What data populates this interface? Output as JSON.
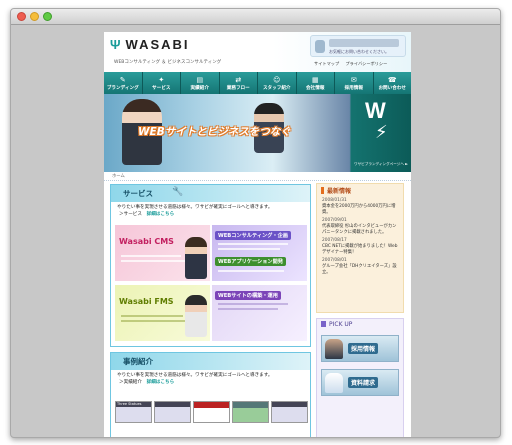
{
  "window": {
    "controls": [
      "close",
      "minimize",
      "zoom"
    ]
  },
  "header": {
    "logo": "WASABI",
    "tagline": "WEBコンサルティング ＆ ビジネスコンサルティング",
    "contact_sub": "お気軽にお問い合わせください。",
    "util_links": [
      "サイトマップ",
      "プライバシーポリシー"
    ]
  },
  "nav": [
    {
      "label": "ブランディング",
      "icon": "✎"
    },
    {
      "label": "サービス",
      "icon": "✦"
    },
    {
      "label": "実績紹介",
      "icon": "▤"
    },
    {
      "label": "業務フロー",
      "icon": "⇄"
    },
    {
      "label": "スタッフ紹介",
      "icon": "☺"
    },
    {
      "label": "会社情報",
      "icon": "▦"
    },
    {
      "label": "採用情報",
      "icon": "✉"
    },
    {
      "label": "お問い合わせ",
      "icon": "☎"
    }
  ],
  "hero": {
    "slogan": "WEBサイトとビジネスをつなぐ",
    "w_letter": "W",
    "w_caption": "ワサビブランディングページへ ►"
  },
  "breadcrumb": "ホーム",
  "service": {
    "title": "サービス",
    "desc": "やりたい事を実現させる道筋は様々。ワサビが確実にゴールへと導きます。",
    "link_prefix": "＞サービス",
    "link": "詳細はこちら",
    "tiles": {
      "cms": "Wasabi CMS",
      "consult": "WEBコンサルティング・企画",
      "fms": "Wasabi FMS",
      "app": "WEBアプリケーション開発",
      "ops": "WEBサイトの構築・運用"
    }
  },
  "cases": {
    "title": "事例紹介",
    "desc": "やりたい事を実現させる道筋は様々。ワサビが確実にゴールへと導きます。",
    "link_prefix": "＞実績紹介",
    "link": "詳細はこちら",
    "thumb_label": "Three Statues"
  },
  "news": {
    "title": "最新情報",
    "items": [
      {
        "date": "2008/01/31",
        "text": "資本金を2000万円から4000万円に増資。"
      },
      {
        "date": "2007/09/01",
        "text": "代表取締役 杉山のインタビューがカンパニータンクに掲載されました。"
      },
      {
        "date": "2007/08/17",
        "text": "CBC NETに掲載が始まりました！Webデザイナー特集！"
      },
      {
        "date": "2007/08/01",
        "text": "グループ会社「DHクリエイターズ」設立。"
      }
    ]
  },
  "pickup": {
    "title": "PICK UP",
    "banners": [
      "採用情報",
      "資料請求"
    ]
  }
}
